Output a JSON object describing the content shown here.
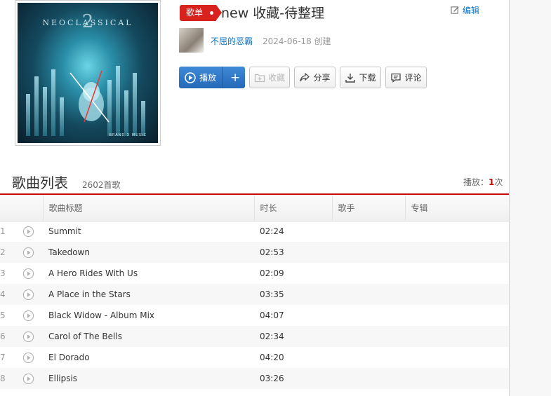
{
  "header": {
    "tag": "歌单",
    "title": "new 收藏-待整理",
    "edit_label": "编辑",
    "creator": "不屈的恶霸",
    "created": "2024-06-18 创建"
  },
  "cover": {
    "title": "NEOCLASSICAL",
    "number": "2",
    "label": "BRAND X MUSIC"
  },
  "actions": {
    "play": "播放",
    "add": "+",
    "collect": "收藏",
    "share": "分享",
    "download": "下载",
    "comment": "评论"
  },
  "list": {
    "heading": "歌曲列表",
    "song_count": "2602首歌",
    "play_prefix": "播放：",
    "play_count": "1",
    "play_suffix": "次",
    "columns": [
      "歌曲标题",
      "时长",
      "歌手",
      "专辑"
    ],
    "tracks": [
      {
        "index": "1",
        "title": "Summit",
        "duration": "02:24"
      },
      {
        "index": "2",
        "title": "Takedown",
        "duration": "02:53"
      },
      {
        "index": "3",
        "title": "A Hero Rides With Us",
        "duration": "02:09"
      },
      {
        "index": "4",
        "title": "A Place in the Stars",
        "duration": "03:35"
      },
      {
        "index": "5",
        "title": "Black Widow - Album Mix",
        "duration": "04:07"
      },
      {
        "index": "6",
        "title": "Carol of The Bells",
        "duration": "02:34"
      },
      {
        "index": "7",
        "title": "El Dorado",
        "duration": "04:20"
      },
      {
        "index": "8",
        "title": "Ellipsis",
        "duration": "03:26"
      }
    ]
  },
  "colors": {
    "accent": "#c20c0c",
    "link": "#0c73c2",
    "play_button": "#2b74c7"
  }
}
